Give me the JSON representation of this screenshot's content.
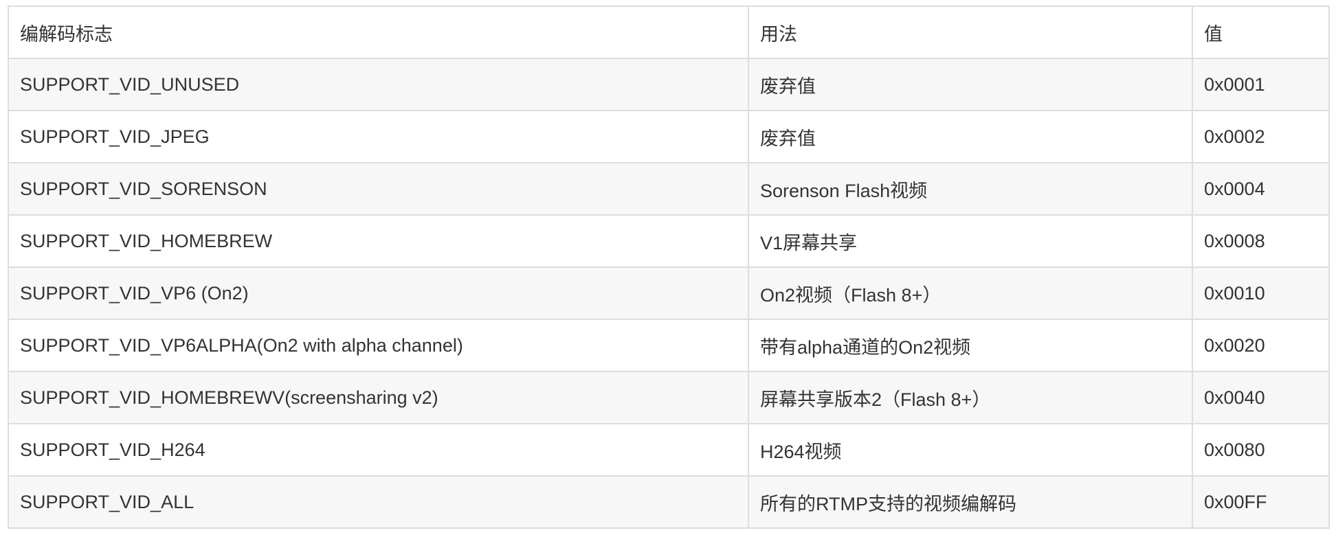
{
  "table": {
    "headers": [
      "编解码标志",
      "用法",
      "值"
    ],
    "rows": [
      [
        "SUPPORT_VID_UNUSED",
        "废弃值",
        "0x0001"
      ],
      [
        "SUPPORT_VID_JPEG",
        "废弃值",
        "0x0002"
      ],
      [
        "SUPPORT_VID_SORENSON",
        "Sorenson Flash视频",
        "0x0004"
      ],
      [
        "SUPPORT_VID_HOMEBREW",
        "V1屏幕共享",
        "0x0008"
      ],
      [
        "SUPPORT_VID_VP6 (On2)",
        "On2视频（Flash 8+）",
        "0x0010"
      ],
      [
        "SUPPORT_VID_VP6ALPHA(On2 with alpha channel)",
        "带有alpha通道的On2视频",
        "0x0020"
      ],
      [
        "SUPPORT_VID_HOMEBREWV(screensharing v2)",
        "屏幕共享版本2（Flash 8+）",
        "0x0040"
      ],
      [
        "SUPPORT_VID_H264",
        "H264视频",
        "0x0080"
      ],
      [
        "SUPPORT_VID_ALL",
        "所有的RTMP支持的视频编解码",
        "0x00FF"
      ]
    ]
  },
  "colors": {
    "border": "#dddddd",
    "stripe": "#f7f7f7",
    "text": "#333333"
  }
}
